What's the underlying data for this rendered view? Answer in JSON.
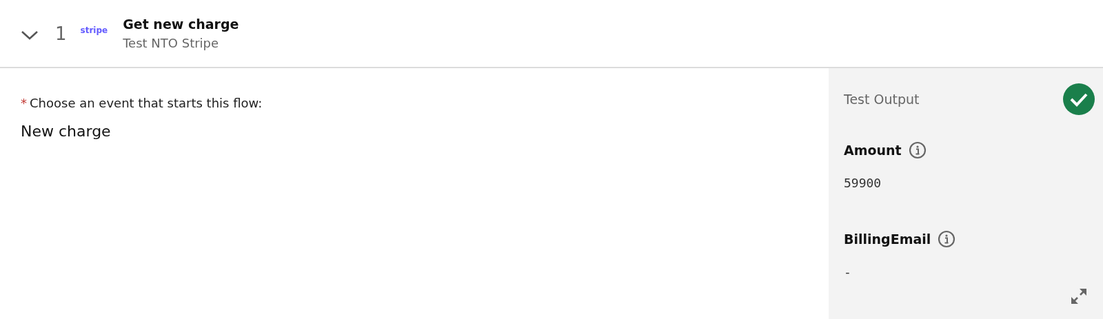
{
  "step": {
    "expanded": true,
    "number": "1",
    "logo": "stripe",
    "title": "Get new charge",
    "subtitle": "Test NTO Stripe"
  },
  "trigger": {
    "required_mark": "*",
    "label": "Choose an event that starts this flow:",
    "value": "New charge"
  },
  "test_output": {
    "title": "Test Output",
    "passed": true,
    "fields": [
      {
        "label": "Amount",
        "value": "59900"
      },
      {
        "label": "BillingEmail",
        "value": "-"
      }
    ]
  }
}
